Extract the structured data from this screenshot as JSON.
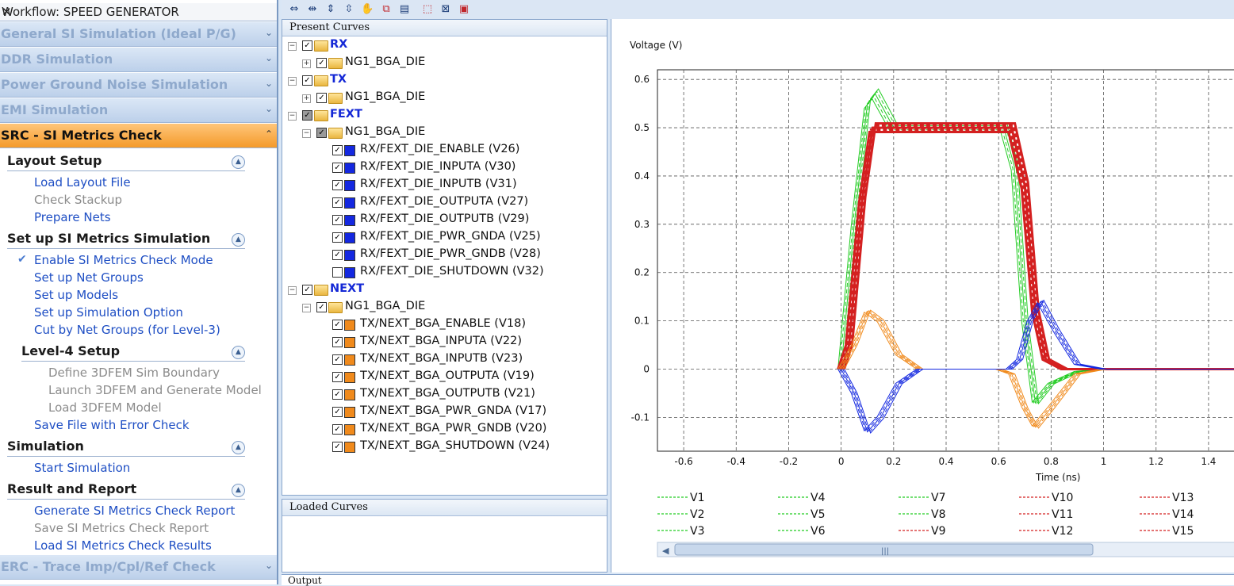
{
  "workflow": {
    "title": "Workflow: SPEED GENERATOR",
    "close_glyph": "✕",
    "collapsed_top": [
      "General SI Simulation (Ideal P/G)",
      "DDR Simulation",
      "Power Ground Noise Simulation",
      "EMI Simulation"
    ],
    "active": "SRC - SI Metrics Check",
    "bottom": "ERC - Trace Imp/Cpl/Ref Check",
    "sections": [
      {
        "title": "Layout Setup",
        "items": [
          "Load Layout File",
          "Check Stackup",
          "Prepare Nets"
        ]
      },
      {
        "title": "Set up SI Metrics Simulation",
        "items": [
          "Enable SI Metrics Check Mode",
          "Set up Net Groups",
          "Set up Models",
          "Set up Simulation Option",
          "Cut by Net Groups (for Level-3)"
        ]
      },
      {
        "title": "Level-4 Setup",
        "items": [
          "Define 3DFEM Sim Boundary",
          "Launch 3DFEM and Generate Model",
          "Load 3DFEM Model",
          "Save File with Error Check"
        ]
      },
      {
        "title": "Simulation",
        "items": [
          "Start Simulation"
        ]
      },
      {
        "title": "Result and Report",
        "items": [
          "Generate SI Metrics Check Report",
          "Save SI Metrics Check Report",
          "Load SI Metrics Check Results"
        ]
      }
    ]
  },
  "present_curves": {
    "header": "Present Curves",
    "groups": [
      {
        "name": "RX",
        "die": "NG1_BGA_DIE"
      },
      {
        "name": "TX",
        "die": "NG1_BGA_DIE"
      },
      {
        "name": "FEXT",
        "die": "NG1_BGA_DIE"
      },
      {
        "name": "NEXT",
        "die": "NG1_BGA_DIE"
      }
    ],
    "fext_curves": [
      "RX/FEXT_DIE_ENABLE (V26)",
      "RX/FEXT_DIE_INPUTA (V30)",
      "RX/FEXT_DIE_INPUTB (V31)",
      "RX/FEXT_DIE_OUTPUTA (V27)",
      "RX/FEXT_DIE_OUTPUTB (V29)",
      "RX/FEXT_DIE_PWR_GNDA (V25)",
      "RX/FEXT_DIE_PWR_GNDB (V28)",
      "RX/FEXT_DIE_SHUTDOWN (V32)"
    ],
    "next_curves": [
      "TX/NEXT_BGA_ENABLE (V18)",
      "TX/NEXT_BGA_INPUTA (V22)",
      "TX/NEXT_BGA_INPUTB (V23)",
      "TX/NEXT_BGA_OUTPUTA (V19)",
      "TX/NEXT_BGA_OUTPUTB (V21)",
      "TX/NEXT_BGA_PWR_GNDA (V17)",
      "TX/NEXT_BGA_PWR_GNDB (V20)",
      "TX/NEXT_BGA_SHUTDOWN (V24)"
    ],
    "fext_color": "#1428e0",
    "next_color": "#f08a1c"
  },
  "loaded_curves": {
    "header": "Loaded Curves"
  },
  "output": {
    "header": "Output"
  },
  "chart_data": {
    "type": "line",
    "ylabel": "Voltage (V)",
    "xlabel": "Time (ns)",
    "xlim": [
      -0.7,
      1.5
    ],
    "ylim": [
      -0.17,
      0.62
    ],
    "xticks": [
      "-0.6",
      "-0.4",
      "-0.2",
      "0",
      "0.2",
      "0.4",
      "0.6",
      "0.8",
      "1",
      "1.2",
      "1.4"
    ],
    "yticks": [
      "0.6",
      "0.5",
      "0.4",
      "0.3",
      "0.2",
      "0.1",
      "0",
      "-0.1"
    ],
    "grid": true,
    "legend_placement": "bottom",
    "legend": [
      "V1",
      "V4",
      "V7",
      "V10",
      "V13",
      "V2",
      "V5",
      "V8",
      "V11",
      "V14",
      "V3",
      "V6",
      "V9",
      "V12",
      "V15"
    ],
    "legend_colors": [
      "#22cc22",
      "#22cc22",
      "#22cc22",
      "#d42020",
      "#d42020",
      "#22cc22",
      "#22cc22",
      "#22cc22",
      "#d42020",
      "#d42020",
      "#22cc22",
      "#22cc22",
      "#d42020",
      "#d42020",
      "#d42020"
    ],
    "series": [
      {
        "color": "#22cc22",
        "x": [
          0,
          0.05,
          0.1,
          0.13,
          0.2,
          0.3,
          0.62,
          0.66,
          0.7,
          0.74,
          0.8,
          0.9,
          1.0,
          1.5
        ],
        "y": [
          0,
          0.3,
          0.55,
          0.57,
          0.5,
          0.5,
          0.5,
          0.42,
          0.1,
          -0.07,
          -0.03,
          -0.005,
          0,
          0
        ]
      },
      {
        "color": "#d42020",
        "x": [
          0,
          0.03,
          0.08,
          0.12,
          0.2,
          0.3,
          0.65,
          0.7,
          0.74,
          0.78,
          0.85,
          1.0,
          1.5
        ],
        "y": [
          0,
          0.05,
          0.35,
          0.5,
          0.5,
          0.5,
          0.5,
          0.38,
          0.12,
          0.02,
          0.0,
          0,
          0
        ]
      },
      {
        "color": "#f08a1c",
        "x": [
          0,
          0.05,
          0.1,
          0.15,
          0.22,
          0.3,
          0.6,
          0.65,
          0.7,
          0.74,
          0.8,
          0.9,
          1.0,
          1.5
        ],
        "y": [
          0,
          0.05,
          0.12,
          0.1,
          0.03,
          0.0,
          0,
          -0.01,
          -0.08,
          -0.12,
          -0.08,
          -0.01,
          0,
          0
        ]
      },
      {
        "color": "#1428e0",
        "x": [
          0,
          0.05,
          0.1,
          0.15,
          0.22,
          0.3,
          0.64,
          0.68,
          0.72,
          0.76,
          0.82,
          0.9,
          1.0,
          1.5
        ],
        "y": [
          0,
          -0.05,
          -0.13,
          -0.1,
          -0.03,
          0.0,
          0,
          0.02,
          0.1,
          0.14,
          0.08,
          0.01,
          0,
          0
        ]
      }
    ]
  }
}
